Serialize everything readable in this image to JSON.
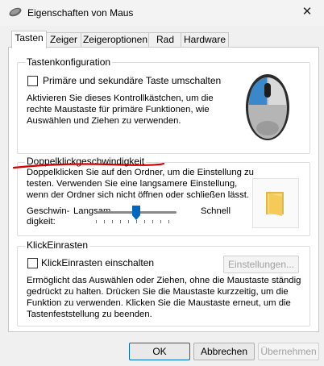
{
  "window": {
    "title": "Eigenschaften von Maus",
    "close_glyph": "✕"
  },
  "tabs": [
    {
      "label": "Tasten"
    },
    {
      "label": "Zeiger"
    },
    {
      "label": "Zeigeroptionen"
    },
    {
      "label": "Rad"
    },
    {
      "label": "Hardware"
    }
  ],
  "button_config": {
    "legend": "Tastenkonfiguration",
    "checkbox_label": "Primäre und sekundäre Taste umschalten",
    "desc_lines": [
      "Aktivieren Sie dieses Kontrollkästchen, um die",
      "rechte Maustaste für primäre Funktionen, wie",
      "Auswählen und Ziehen zu verwenden."
    ]
  },
  "double_click": {
    "legend": "Doppelklickgeschwindigkeit",
    "desc_lines": [
      "Doppelklicken Sie auf den Ordner, um die Einstellung zu",
      "testen. Verwenden Sie eine langsamere Einstellung,",
      "wenn der Ordner sich nicht öffnen oder schließen lässt."
    ],
    "speed_label_1": "Geschwin-",
    "speed_label_2": "digkeit:",
    "slow": "Langsam",
    "fast": "Schnell",
    "slider_position": 0.5
  },
  "clicklock": {
    "legend": "KlickEinrasten",
    "checkbox_label": "KlickEinrasten einschalten",
    "settings_button": "Einstellungen...",
    "desc_lines": [
      "Ermöglicht das Auswählen oder Ziehen, ohne die Maustaste ständig",
      "gedrückt zu halten. Drücken Sie die Maustaste kurzzeitig, um die",
      "Funktion zu verwenden. Klicken Sie die Maustaste erneut, um die",
      "Tastenfeststellung zu beenden."
    ]
  },
  "footer": {
    "ok": "OK",
    "cancel": "Abbrechen",
    "apply": "Übernehmen"
  },
  "colors": {
    "annotation_red": "#d40000",
    "accent": "#0067c0"
  }
}
